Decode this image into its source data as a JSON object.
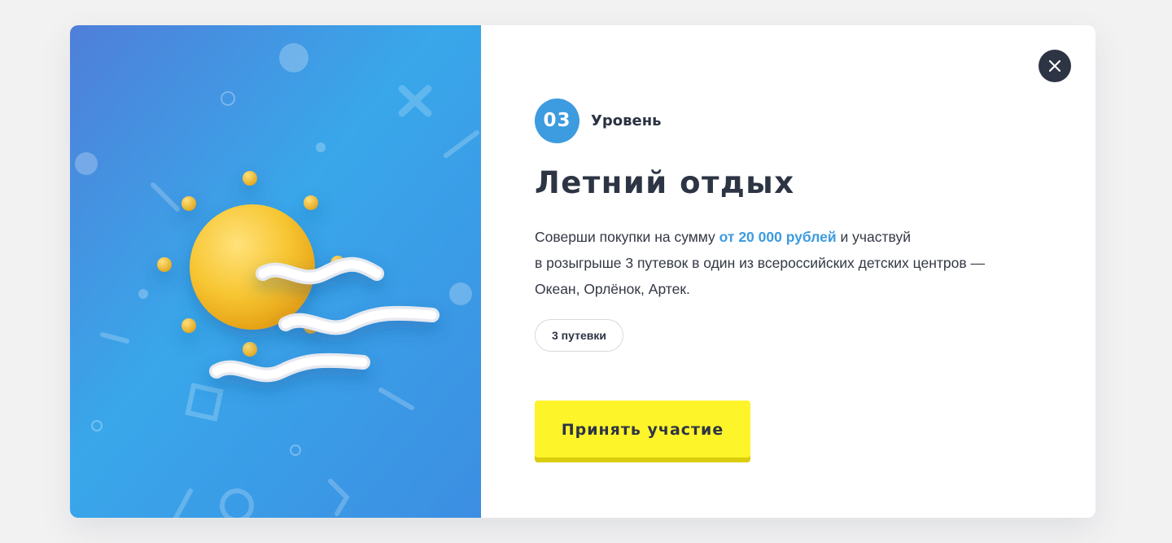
{
  "modal": {
    "level": {
      "number": "03",
      "label": "Уровень"
    },
    "title": "Летний отдых",
    "description": {
      "line1_before": "Соверши покупки на сумму ",
      "line1_highlight": "от 20 000 рублей",
      "line1_after": " и участвуй",
      "line2": "в розыгрыше 3 путевок в один из всероссийских детских центров —",
      "line3": "Океан, Орлёнок, Артек."
    },
    "tag": "3 путевки",
    "cta_label": "Принять участие",
    "close_icon": "close-icon",
    "illustration_icon": "sun-and-waves-illustration"
  },
  "colors": {
    "accent_blue": "#3d9be0",
    "cta_yellow": "#fef42a",
    "dark_text": "#2d3444",
    "close_bg": "#2d3444"
  }
}
